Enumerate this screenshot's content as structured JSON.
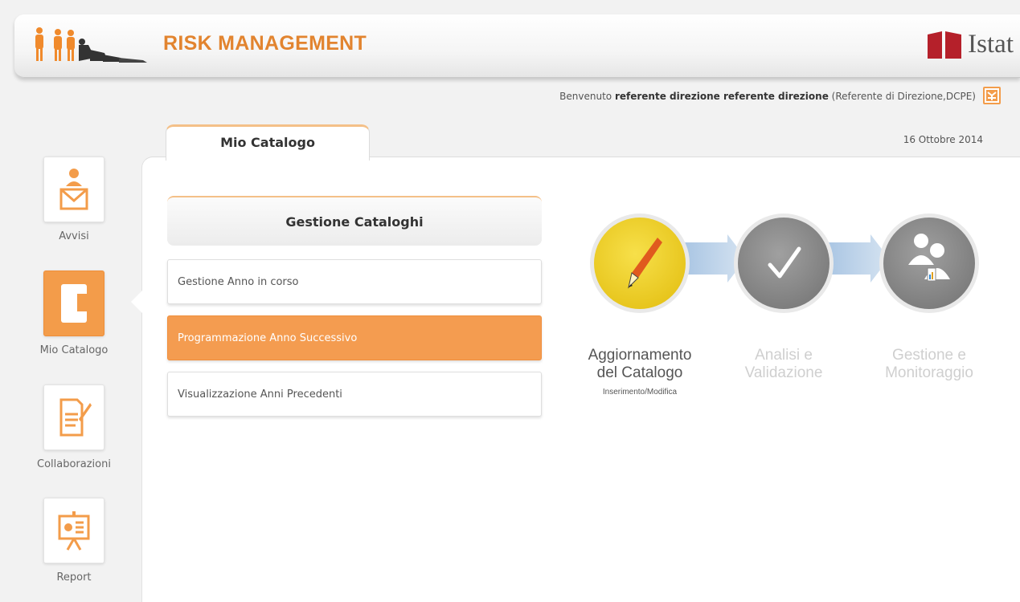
{
  "app": {
    "title": "RISK MANAGEMENT",
    "org": "Istat"
  },
  "welcome": {
    "prefix": "Benvenuto",
    "user": "referente direzione referente direzione",
    "role": "(Referente di Direzione,DCPE)"
  },
  "date": "16 Ottobre 2014",
  "tab": {
    "label": "Mio Catalogo"
  },
  "sidebar": {
    "items": [
      {
        "label": "Avvisi",
        "icon": "mail-user-icon",
        "active": false
      },
      {
        "label": "Mio Catalogo",
        "icon": "catalog-icon",
        "active": true
      },
      {
        "label": "Collaborazioni",
        "icon": "edit-document-icon",
        "active": false
      },
      {
        "label": "Report",
        "icon": "presentation-icon",
        "active": false
      }
    ]
  },
  "catalog": {
    "header": "Gestione Cataloghi",
    "items": [
      {
        "label": "Gestione Anno in corso",
        "active": false
      },
      {
        "label": "Programmazione Anno Successivo",
        "active": true
      },
      {
        "label": "Visualizzazione Anni Precedenti",
        "active": false
      }
    ]
  },
  "workflow": {
    "steps": [
      {
        "line1": "Aggiornamento",
        "line2": "del Catalogo",
        "sub": "Inserimento/Modifica",
        "icon": "pencil-icon",
        "state": "active",
        "color": "#f2d32a"
      },
      {
        "line1": "Analisi e",
        "line2": "Validazione",
        "sub": "",
        "icon": "check-icon",
        "state": "inactive",
        "color": "#8e8e8e"
      },
      {
        "line1": "Gestione e",
        "line2": "Monitoraggio",
        "sub": "",
        "icon": "people-icon",
        "state": "inactive",
        "color": "#8e8e8e"
      }
    ]
  },
  "colors": {
    "accent": "#f39c4a",
    "title": "#e2842f",
    "istat_red": "#b5202a"
  }
}
